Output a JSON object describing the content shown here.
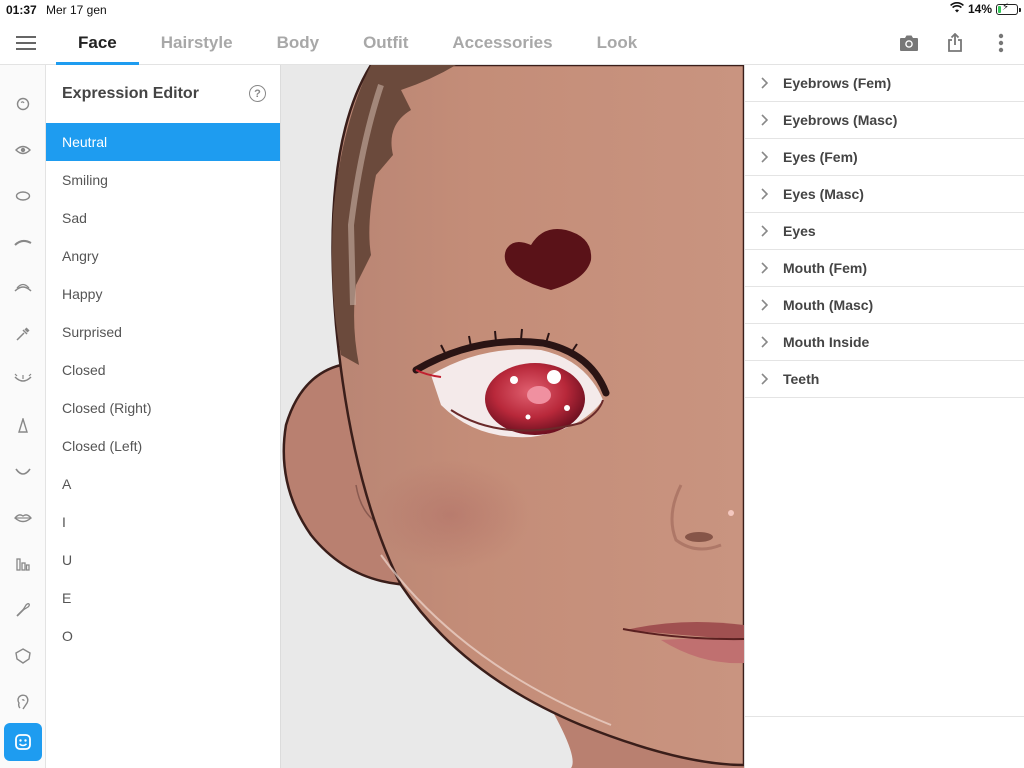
{
  "status_bar": {
    "time": "01:37",
    "date": "Mer 17 gen",
    "battery_percent": "14%",
    "battery_level": 0.14
  },
  "nav": {
    "tabs": [
      {
        "label": "Face",
        "active": true
      },
      {
        "label": "Hairstyle",
        "active": false
      },
      {
        "label": "Body",
        "active": false
      },
      {
        "label": "Outfit",
        "active": false
      },
      {
        "label": "Accessories",
        "active": false
      },
      {
        "label": "Look",
        "active": false
      }
    ],
    "actions": [
      "camera-icon",
      "share-icon",
      "more-vertical-icon"
    ],
    "accent_color": "#1e9cf0"
  },
  "icon_rail": {
    "items": [
      "face-outline-icon",
      "eye-icon",
      "eye-outline-icon",
      "eyebrow-icon",
      "eyelash-icon",
      "eyeliner-brush-icon",
      "lower-lashes-icon",
      "nose-icon",
      "mouth-icon",
      "lips-icon",
      "teeth-icon",
      "makeup-brush-icon",
      "face-shape-icon",
      "ear-icon",
      "expression-face-icon"
    ],
    "active_index": 14
  },
  "expression_editor": {
    "title": "Expression Editor",
    "help_label": "?",
    "items": [
      {
        "label": "Neutral",
        "selected": true
      },
      {
        "label": "Smiling",
        "selected": false
      },
      {
        "label": "Sad",
        "selected": false
      },
      {
        "label": "Angry",
        "selected": false
      },
      {
        "label": "Happy",
        "selected": false
      },
      {
        "label": "Surprised",
        "selected": false
      },
      {
        "label": "Closed",
        "selected": false
      },
      {
        "label": "Closed (Right)",
        "selected": false
      },
      {
        "label": "Closed (Left)",
        "selected": false
      },
      {
        "label": "A",
        "selected": false
      },
      {
        "label": "I",
        "selected": false
      },
      {
        "label": "U",
        "selected": false
      },
      {
        "label": "E",
        "selected": false
      },
      {
        "label": "O",
        "selected": false
      }
    ]
  },
  "blendshape_groups": {
    "items": [
      "Eyebrows (Fem)",
      "Eyebrows (Masc)",
      "Eyes (Fem)",
      "Eyes (Masc)",
      "Eyes",
      "Mouth (Fem)",
      "Mouth (Masc)",
      "Mouth Inside",
      "Teeth"
    ]
  },
  "colors": {
    "skin": "#c48d78",
    "hair": "#6b4a3c",
    "iris": "#b8283a",
    "heart_mark": "#5a1218"
  }
}
